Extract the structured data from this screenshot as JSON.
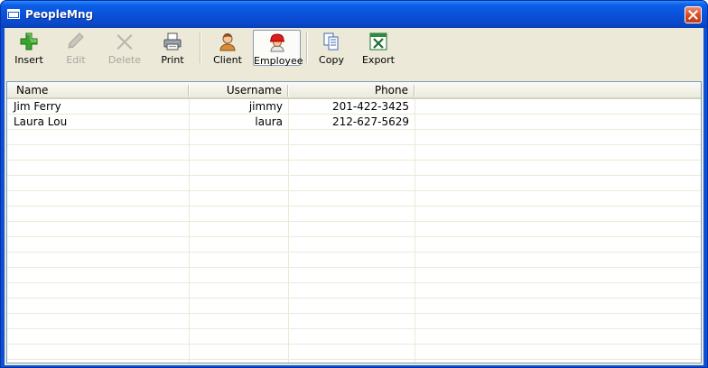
{
  "window": {
    "title": "PeopleMng"
  },
  "toolbar": {
    "insert": "Insert",
    "edit": "Edit",
    "delete": "Delete",
    "print": "Print",
    "client": "Client",
    "employee": "Employee",
    "copy": "Copy",
    "export": "Export"
  },
  "table": {
    "columns": [
      "Name",
      "Username",
      "Phone"
    ],
    "rows": [
      {
        "name": "Jim Ferry",
        "username": "jimmy",
        "phone": "201-422-3425"
      },
      {
        "name": "Laura Lou",
        "username": "laura",
        "phone": "212-627-5629"
      }
    ]
  }
}
